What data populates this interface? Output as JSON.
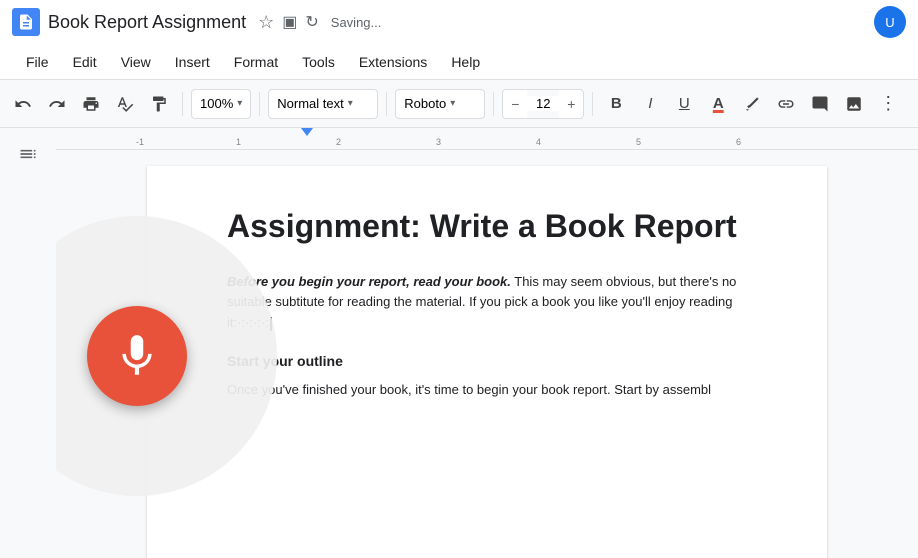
{
  "titleBar": {
    "docTitle": "Book Report Assignment",
    "savingText": "Saving...",
    "docIconAlt": "google-docs-icon"
  },
  "menuBar": {
    "items": [
      "File",
      "Edit",
      "View",
      "Insert",
      "Format",
      "Tools",
      "Extensions",
      "Help"
    ]
  },
  "toolbar": {
    "undoLabel": "↩",
    "redoLabel": "↪",
    "printLabel": "🖨",
    "spellcheckLabel": "✓",
    "paintFormatLabel": "🎨",
    "zoomLevel": "100%",
    "zoomArrow": "▾",
    "paragraphStyle": "Normal text",
    "paragraphArrow": "▾",
    "fontFamily": "Roboto",
    "fontFamilyArrow": "▾",
    "fontSizeMinus": "−",
    "fontSize": "12",
    "fontSizePlus": "+",
    "boldLabel": "B",
    "italicLabel": "I",
    "underlineLabel": "U",
    "fontColorLabel": "A",
    "highlightLabel": "✏",
    "linkLabel": "🔗",
    "insertCommentLabel": "💬",
    "insertImageLabel": "🖼",
    "moreLabel": "≡"
  },
  "ruler": {
    "marks": [
      "-1",
      "1",
      "2",
      "3",
      "4",
      "5",
      "6"
    ],
    "trianglePos": 245
  },
  "sidebar": {
    "outlineIcon": "≡"
  },
  "document": {
    "title": "Assignment: Write a Book Report",
    "body": {
      "paragraph1": {
        "boldItalicPart": "Before you begin your report, read your book.",
        "normalPart": " This may seem obvious, but there's no suitable subtitute for reading the material. If you pick a book you like you'll enjoy reading it:·:·:·:·:"
      },
      "section1Title": "Start your outline",
      "section1Body": "Once you've finished your book, it's time to begin your book report. Start by assembl"
    }
  },
  "voiceButton": {
    "label": "voice-input",
    "ariaLabel": "Start voice typing"
  }
}
